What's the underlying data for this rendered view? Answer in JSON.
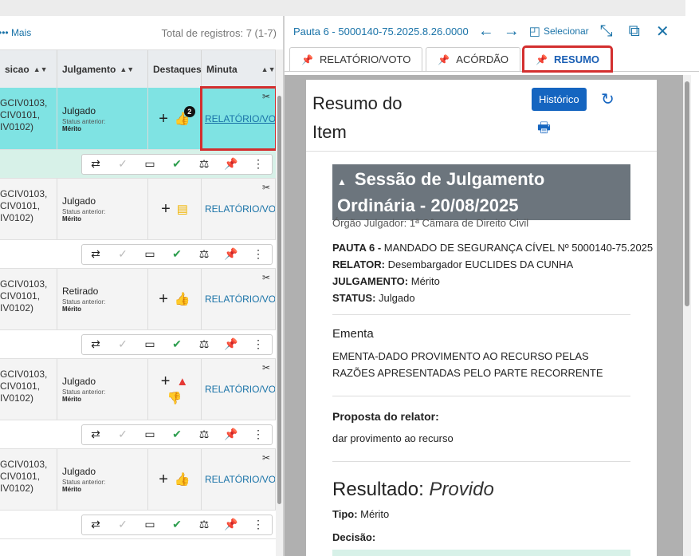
{
  "left": {
    "mais_label": "••• Mais",
    "total": "Total de registros: 7 (1-7)",
    "columns": {
      "c1": "sicao",
      "c2": "Julgamento",
      "c3": "Destaques",
      "c4": "Minuta"
    },
    "rows": [
      {
        "code": "GCIV0103,\nCIV0101,\nIV0102)",
        "julg": "Julgado",
        "status_label": "Status anterior:",
        "status": "Mérito",
        "minuta": "RELATÓRIO/VOTO",
        "badge": "2"
      },
      {
        "code": "GCIV0103,\nCIV0101,\nIV0102)",
        "julg": "Julgado",
        "status_label": "Status anterior:",
        "status": "Mérito",
        "minuta": "RELATÓRIO/VOTO"
      },
      {
        "code": "GCIV0103,\nCIV0101,\nIV0102)",
        "julg": "Retirado",
        "status_label": "Status anterior:",
        "status": "Mérito",
        "minuta": "RELATÓRIO/VOTO"
      },
      {
        "code": "GCIV0103,\nCIV0101,\nIV0102)",
        "julg": "Julgado",
        "status_label": "Status anterior:",
        "status": "Mérito",
        "minuta": "RELATÓRIO/VOTO"
      },
      {
        "code": "GCIV0103,\nCIV0101,\nIV0102)",
        "julg": "Julgado",
        "status_label": "Status anterior:",
        "status": "Mérito",
        "minuta": "RELATÓRIO/VOTO"
      }
    ]
  },
  "right": {
    "pauta": "Pauta 6 - 5000140-75.2025.8.26.0000",
    "selecionar": "Selecionar",
    "tabs": [
      "RELATÓRIO/VOTO",
      "ACÓRDÃO",
      "RESUMO"
    ],
    "card_title_1": "Resumo do",
    "card_title_2": "Item",
    "historico": "Histórico",
    "session_1": "Sessão de Julgamento",
    "session_2": "Ordinária - 20/08/2025",
    "orgao": "Órgão Julgador: 1ª Câmara de Direito Civil",
    "pauta_label": "PAUTA 6 -",
    "pauta_val": "MANDADO DE SEGURANÇA CÍVEL Nº 5000140-75.2025",
    "relator_label": "RELATOR:",
    "relator_val": "Desembargador EUCLIDES DA CUNHA",
    "julg_label": "JULGAMENTO:",
    "julg_val": "Mérito",
    "status_label": "STATUS:",
    "status_val": "Julgado",
    "ementa_h": "Ementa",
    "ementa_t": "EMENTA-DADO PROVIMENTO AO RECURSO PELAS RAZÕES APRESENTADAS PELO PARTE RECORRENTE",
    "proposta_h": "Proposta do relator:",
    "proposta_t": "dar provimento ao recurso",
    "resultado_label": "Resultado:",
    "resultado_val": "Provido",
    "tipo_label": "Tipo:",
    "tipo_val": "Mérito",
    "decisao_label": "Decisão:"
  }
}
